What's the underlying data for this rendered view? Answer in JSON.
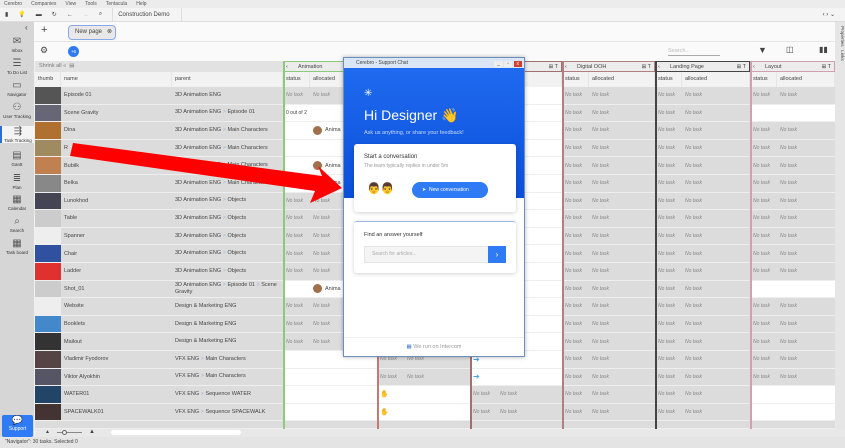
{
  "menu": [
    "Cerebro",
    "Companies",
    "View",
    "Tools",
    "Tentacula",
    "Help"
  ],
  "toolbar": {
    "path": "Construction Demo Case"
  },
  "sidebar": [
    {
      "label": "Inbox",
      "icon": "✉"
    },
    {
      "label": "To Do List",
      "icon": "☰"
    },
    {
      "label": "Navigator",
      "icon": "▭"
    },
    {
      "label": "User Tracking",
      "icon": "⚇"
    },
    {
      "label": "Task Tracking",
      "icon": "⇶"
    },
    {
      "label": "Gantt",
      "icon": "▤"
    },
    {
      "label": "Plan",
      "icon": "≣"
    },
    {
      "label": "Calendar",
      "icon": "▦"
    },
    {
      "label": "Search",
      "icon": "⌕"
    },
    {
      "label": "Task board",
      "icon": "▦"
    }
  ],
  "support": "Support",
  "tabs": {
    "add": "+",
    "new_page": "New page",
    "badge": "+6"
  },
  "search_placeholder": "Search...",
  "shrink_all": "Shrink all",
  "columns": {
    "thumb": "thumb",
    "name": "name",
    "parent": "parent",
    "status": "status",
    "allocated": "allocated"
  },
  "groups": [
    "Animation",
    "",
    "",
    "Digital OOH",
    "Landing Page",
    "Layout"
  ],
  "right_tabs": [
    "Properties",
    "Links"
  ],
  "no_task": "No task",
  "anim_name": "Anima",
  "rows": [
    {
      "name": "Episode 01",
      "parent": [
        "3D Animation ENG"
      ],
      "anim": "nt",
      "c2": "",
      "c3": "",
      "d": "nt",
      "l": "nt",
      "y": "nt"
    },
    {
      "name": "Scene Gravity",
      "parent": [
        "3D Animation ENG",
        "Episode 01"
      ],
      "anim": "0 out of 2",
      "c2": "",
      "c3": "",
      "d": "nt",
      "l": "nt",
      "y": ""
    },
    {
      "name": "Dina",
      "parent": [
        "3D Animation ENG",
        "Main Characters"
      ],
      "anim": "av",
      "c2": "",
      "c3": "",
      "d": "nt",
      "l": "nt",
      "y": "nt"
    },
    {
      "name": "R",
      "parent": [
        "3D Animation ENG",
        "Main Characters"
      ],
      "anim": "",
      "c2": "",
      "c3": "",
      "d": "nt",
      "l": "nt",
      "y": "nt"
    },
    {
      "name": "Bubilk",
      "parent": [
        "3D Animation ENG",
        "Main Characters"
      ],
      "anim": "av",
      "c2": "",
      "c3": "",
      "d": "nt",
      "l": "nt",
      "y": "nt"
    },
    {
      "name": "Belka",
      "parent": [
        "3D Animation ENG",
        "Main Characters"
      ],
      "anim": "av",
      "c2": "",
      "c3": "",
      "d": "nt",
      "l": "nt",
      "y": "nt"
    },
    {
      "name": "Lunokhod",
      "parent": [
        "3D Animation ENG",
        "Objects"
      ],
      "anim": "nt",
      "c2": "",
      "c3": "",
      "d": "nt",
      "l": "nt",
      "y": "nt"
    },
    {
      "name": "Table",
      "parent": [
        "3D Animation ENG",
        "Objects"
      ],
      "anim": "nt",
      "c2": "",
      "c3": "",
      "d": "nt",
      "l": "nt",
      "y": "nt"
    },
    {
      "name": "Spanner",
      "parent": [
        "3D Animation ENG",
        "Objects"
      ],
      "anim": "nt",
      "c2": "",
      "c3": "",
      "d": "nt",
      "l": "nt",
      "y": "nt"
    },
    {
      "name": "Chair",
      "parent": [
        "3D Animation ENG",
        "Objects"
      ],
      "anim": "nt",
      "c2": "",
      "c3": "",
      "d": "nt",
      "l": "nt",
      "y": "nt"
    },
    {
      "name": "Ladder",
      "parent": [
        "3D Animation ENG",
        "Objects"
      ],
      "anim": "nt",
      "c2": "",
      "c3": "",
      "d": "nt",
      "l": "nt",
      "y": "nt"
    },
    {
      "name": "Shot_01",
      "parent": [
        "3D Animation ENG",
        "Episode 01",
        "Scene Gravity"
      ],
      "anim": "av",
      "c2": "",
      "c3": "",
      "d": "nt",
      "l": "nt",
      "y": ""
    },
    {
      "name": "Website",
      "parent": [
        "Design & Marketing ENG"
      ],
      "anim": "nt",
      "c2": "",
      "c3": "",
      "d": "nt",
      "l": "nt",
      "y": "nt"
    },
    {
      "name": "Booklets",
      "parent": [
        "Design & Marketing ENG"
      ],
      "anim": "nt",
      "c2": "",
      "c3": "",
      "d": "nt",
      "l": "nt",
      "y": "nt"
    },
    {
      "name": "Mailout",
      "parent": [
        "Design & Marketing ENG"
      ],
      "anim": "nt",
      "c2": "",
      "c3": "",
      "d": "nt",
      "l": "nt",
      "y": "nt"
    },
    {
      "name": "Vladimir Fyodorov",
      "parent": [
        "VFX ENG",
        "Main Characters"
      ],
      "anim": "",
      "c2": "nt",
      "c3": "arrow",
      "d": "nt",
      "l": "nt",
      "y": "nt"
    },
    {
      "name": "Viktor Alyokhin",
      "parent": [
        "VFX ENG",
        "Main Characters"
      ],
      "anim": "",
      "c2": "nt",
      "c3": "arrow",
      "d": "nt",
      "l": "nt",
      "y": "nt"
    },
    {
      "name": "WATER01",
      "parent": [
        "VFX ENG",
        "Sequence WATER"
      ],
      "anim": "",
      "c2": "icon",
      "c3": "nt",
      "d": "nt",
      "l": "nt",
      "y": ""
    },
    {
      "name": "SPACEWALK01",
      "parent": [
        "VFX ENG",
        "Sequence SPACEWALK"
      ],
      "anim": "",
      "c2": "icon",
      "c3": "nt",
      "d": "nt",
      "l": "nt",
      "y": ""
    }
  ],
  "chat": {
    "window_title": "Cerebro - Support Chat",
    "greeting": "Hi Designer 👋",
    "subtitle": "Ask us anything, or share your feedback!",
    "start_title": "Start a conversation",
    "start_sub": "The team typically replies in under 5m",
    "new_conv": "New conversation",
    "find_title": "Find an answer yourself",
    "search_placeholder": "Search for articles...",
    "footer": "We run on Intercom"
  },
  "status": "\"Navigator\": 30 tasks. Selected 0",
  "colors": {
    "accent": "#2f7bf5",
    "arrow": "#ff0000",
    "anim_border": "#8cc97a"
  }
}
